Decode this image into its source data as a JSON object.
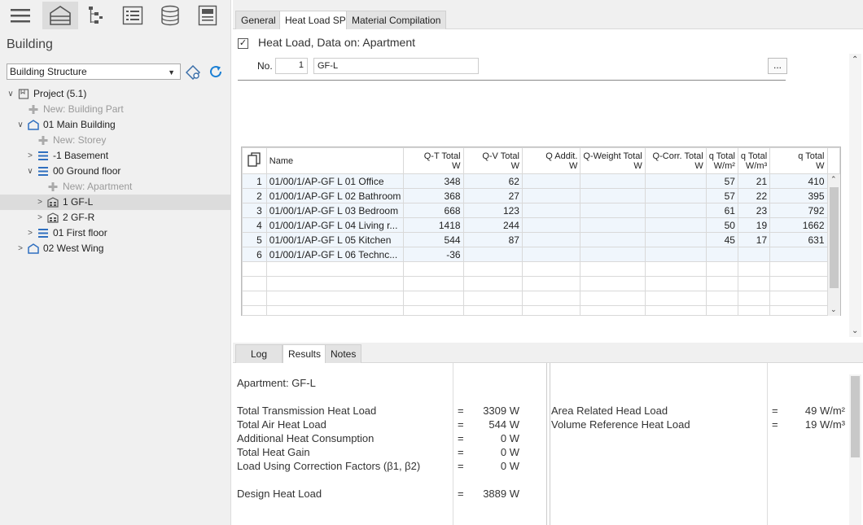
{
  "left_panel": {
    "title": "Building",
    "view_select": "Building Structure",
    "tree": [
      {
        "label": "Project (5.1)",
        "level": 0,
        "icon": "project-icon",
        "expanded": true
      },
      {
        "label": "New: Building Part",
        "level": 1,
        "icon": "plus-icon",
        "new": true
      },
      {
        "label": "01 Main Building",
        "level": 1,
        "icon": "building-icon",
        "expanded": true
      },
      {
        "label": "New: Storey",
        "level": 2,
        "icon": "plus-icon",
        "new": true
      },
      {
        "label": "-1 Basement",
        "level": 2,
        "icon": "storey-icon",
        "expanded": false
      },
      {
        "label": "00 Ground floor",
        "level": 2,
        "icon": "storey-icon",
        "expanded": true
      },
      {
        "label": "New: Apartment",
        "level": 3,
        "icon": "plus-icon",
        "new": true
      },
      {
        "label": "1 GF-L",
        "level": 3,
        "icon": "apartment-icon",
        "expanded": false,
        "selected": true
      },
      {
        "label": "2 GF-R",
        "level": 3,
        "icon": "apartment-icon",
        "expanded": false
      },
      {
        "label": "01 First floor",
        "level": 2,
        "icon": "storey-icon",
        "expanded": false
      },
      {
        "label": "02 West Wing",
        "level": 1,
        "icon": "building-icon",
        "expanded": false
      }
    ]
  },
  "tabs": [
    "General",
    "Heat Load SP",
    "Material Compilation"
  ],
  "active_tab": "Heat Load SP",
  "header": {
    "title": "Heat Load, Data on: Apartment",
    "no_label": "No.",
    "no_value": "1",
    "name_value": "GF-L",
    "more_button": "..."
  },
  "table": {
    "columns": [
      {
        "label": "Name",
        "unit": ""
      },
      {
        "label": "Q-T Total",
        "unit": "W"
      },
      {
        "label": "Q-V Total",
        "unit": "W"
      },
      {
        "label": "Q Addit.",
        "unit": "W"
      },
      {
        "label": "Q-Weight Total",
        "unit": "W"
      },
      {
        "label": "Q-Corr. Total",
        "unit": "W"
      },
      {
        "label": "q Total",
        "unit": "W/m²"
      },
      {
        "label": "q Total",
        "unit": "W/m³"
      },
      {
        "label": "q Total",
        "unit": "W"
      }
    ],
    "rows": [
      {
        "no": "1",
        "cells": [
          "01/00/1/AP-GF L 01 Office",
          "348",
          "62",
          "",
          "",
          "",
          "57",
          "21",
          "410"
        ]
      },
      {
        "no": "2",
        "cells": [
          "01/00/1/AP-GF L 02 Bathroom",
          "368",
          "27",
          "",
          "",
          "",
          "57",
          "22",
          "395"
        ]
      },
      {
        "no": "3",
        "cells": [
          "01/00/1/AP-GF L 03 Bedroom",
          "668",
          "123",
          "",
          "",
          "",
          "61",
          "23",
          "792"
        ]
      },
      {
        "no": "4",
        "cells": [
          "01/00/1/AP-GF L 04 Living r...",
          "1418",
          "244",
          "",
          "",
          "",
          "50",
          "19",
          "1662"
        ]
      },
      {
        "no": "5",
        "cells": [
          "01/00/1/AP-GF L 05 Kitchen",
          "544",
          "87",
          "",
          "",
          "",
          "45",
          "17",
          "631"
        ]
      },
      {
        "no": "6",
        "cells": [
          "01/00/1/AP-GF L 06 Technc...",
          "-36",
          "",
          "",
          "",
          "",
          "",
          "",
          ""
        ]
      }
    ]
  },
  "bottom_tabs": [
    "Log",
    "Results",
    "Notes"
  ],
  "active_bottom_tab": "Results",
  "results": {
    "apartment": "Apartment: GF-L",
    "items_left": [
      {
        "label": "Total Transmission Heat Load",
        "eq": "=",
        "value": "3309 W"
      },
      {
        "label": "Total Air Heat Load",
        "eq": "=",
        "value": "544 W"
      },
      {
        "label": "Additional Heat Consumption",
        "eq": "=",
        "value": "0 W"
      },
      {
        "label": "Total Heat Gain",
        "eq": "=",
        "value": "0 W"
      },
      {
        "label": "Load Using Correction Factors (β1, β2)",
        "eq": "=",
        "value": "0 W"
      }
    ],
    "design": {
      "label": "Design Heat Load",
      "eq": "=",
      "value": "3889 W"
    },
    "items_right": [
      {
        "label": "Area Related Head Load",
        "eq": "=",
        "value": "49 W/m²"
      },
      {
        "label": "Volume Reference Heat Load",
        "eq": "=",
        "value": "19 W/m³"
      }
    ]
  }
}
